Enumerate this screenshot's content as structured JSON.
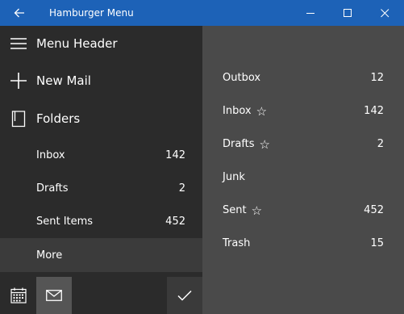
{
  "window": {
    "title": "Hamburger Menu"
  },
  "pane": {
    "header_label": "Menu Header",
    "new_mail_label": "New Mail",
    "folders_label": "Folders",
    "items": [
      {
        "label": "Inbox",
        "count": "142"
      },
      {
        "label": "Drafts",
        "count": "2"
      },
      {
        "label": "Sent Items",
        "count": "452"
      }
    ],
    "more_label": "More"
  },
  "main": {
    "rows": [
      {
        "label": "Outbox",
        "starred": false,
        "star": "",
        "count": "12"
      },
      {
        "label": "Inbox",
        "starred": true,
        "star": "☆",
        "count": "142"
      },
      {
        "label": "Drafts",
        "starred": true,
        "star": "☆",
        "count": "2"
      },
      {
        "label": "Junk",
        "starred": false,
        "star": "",
        "count": ""
      },
      {
        "label": "Sent",
        "starred": true,
        "star": "☆",
        "count": "452"
      },
      {
        "label": "Trash",
        "starred": false,
        "star": "",
        "count": "15"
      }
    ]
  },
  "colors": {
    "titlebar": "#1d62b7",
    "pane": "#2b2b2b",
    "main": "#4a4a4a",
    "more_row": "#3b3b3b",
    "selected_bottom": "#555555"
  },
  "icons": [
    "back-arrow-icon",
    "minimize-icon",
    "maximize-icon",
    "close-icon",
    "hamburger-icon",
    "plus-icon",
    "folder-icon",
    "calendar-icon",
    "mail-icon",
    "checkmark-icon",
    "star-outline-icon"
  ]
}
